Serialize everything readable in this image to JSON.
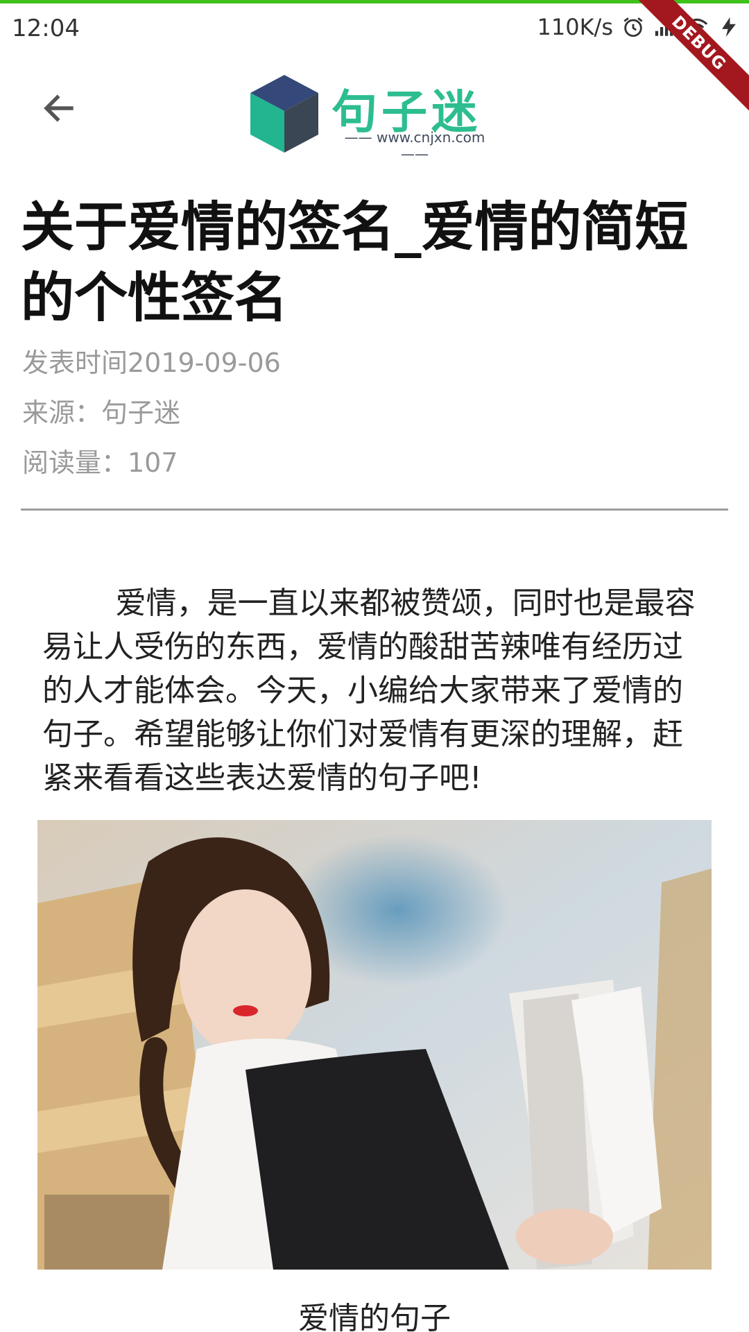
{
  "status_bar": {
    "time": "12:04",
    "network_speed": "110K/s",
    "icons": [
      "alarm-icon",
      "signal-icon",
      "wifi-icon",
      "charging-icon"
    ]
  },
  "debug_banner": "DEBUG",
  "header": {
    "back_icon": "arrow-left-icon",
    "logo_title": "句子迷",
    "logo_url": "—— www.cnjxn.com ——"
  },
  "article": {
    "title": "关于爱情的签名_爱情的简短的个性签名",
    "publish_time": "发表时间2019-09-06",
    "source": "来源：句子迷",
    "read_count": "阅读量：107",
    "body": "爱情，是一直以来都被赞颂，同时也是最容易让人受伤的东西，爱情的酸甜苦辣唯有经历过的人才能体会。今天，小编给大家带来了爱情的句子。希望能够让你们对爱情有更深的理解，赶紧来看看这些表达爱情的句子吧!",
    "image_caption": "爱情的句子"
  },
  "colors": {
    "top_accent": "#3ec21a",
    "logo_green": "#2dbd90",
    "meta_gray": "#9a9a9a",
    "debug_red": "#a3181f"
  }
}
